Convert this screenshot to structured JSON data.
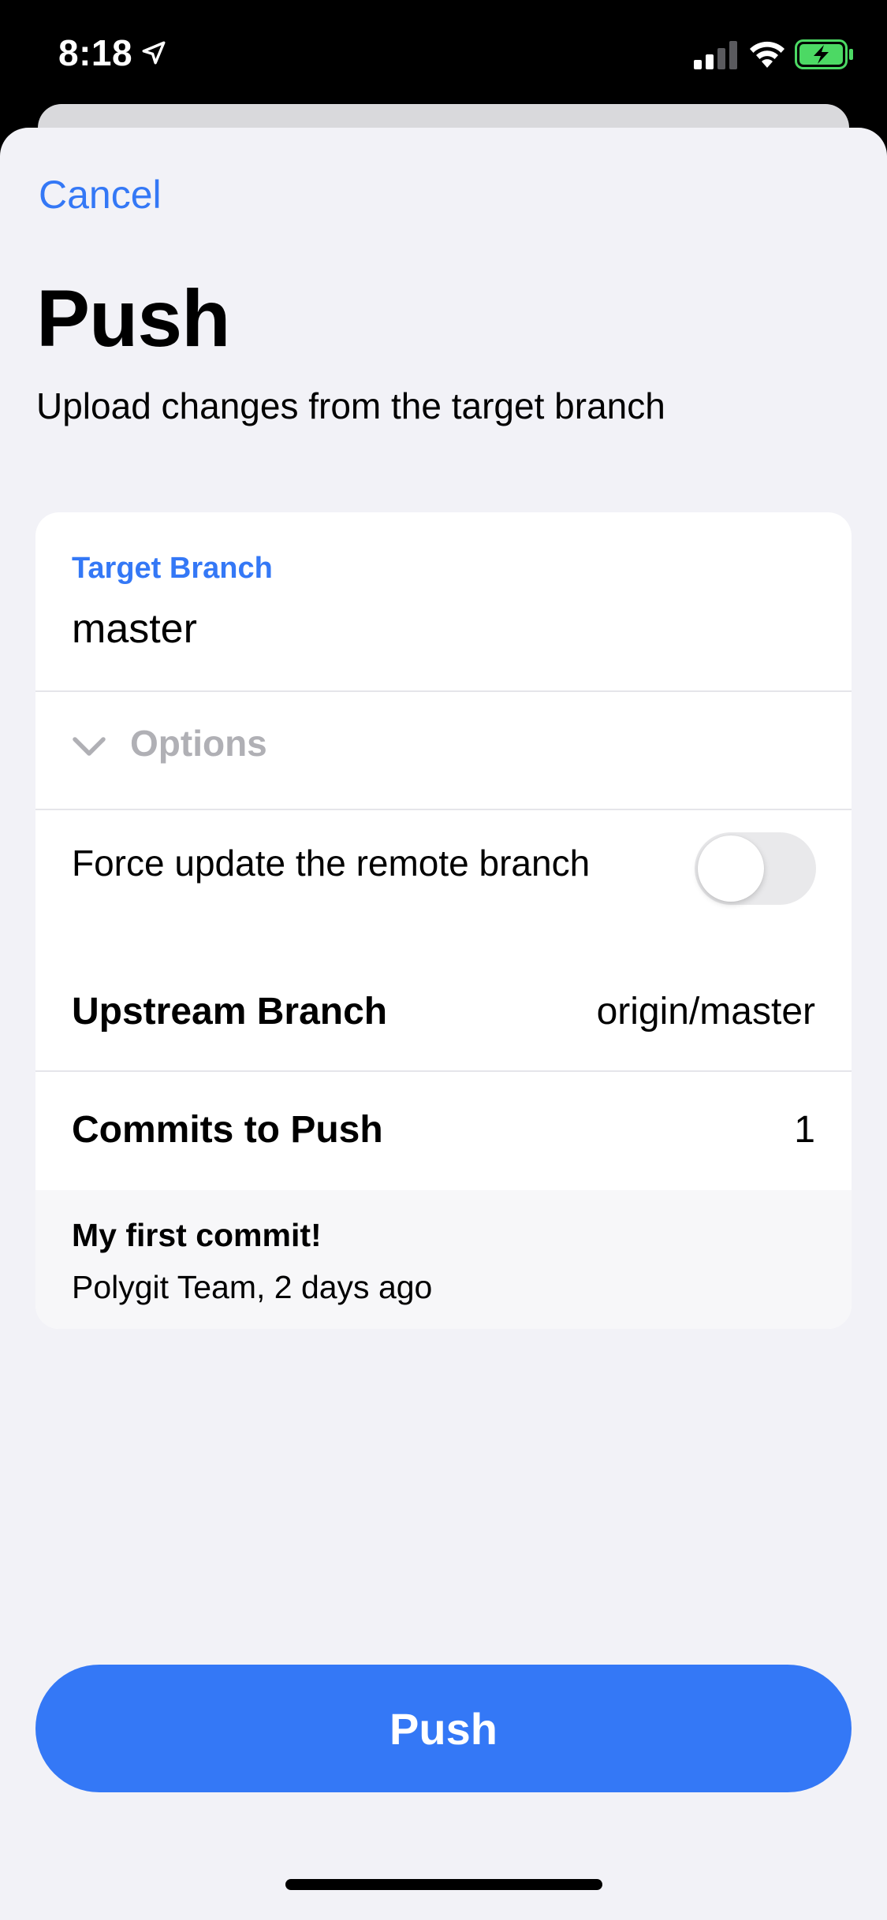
{
  "status_bar": {
    "time": "8:18",
    "location_icon": "location-arrow-icon",
    "signal_icon": "cellular-signal-icon",
    "wifi_icon": "wifi-icon",
    "battery_icon": "battery-charging-icon",
    "battery_color": "#4cd964"
  },
  "nav": {
    "cancel_label": "Cancel"
  },
  "header": {
    "title": "Push",
    "subtitle": "Upload changes from the target branch"
  },
  "target_branch": {
    "label": "Target Branch",
    "value": "master"
  },
  "options": {
    "label": "Options",
    "icon": "chevron-down-icon",
    "expanded": false
  },
  "force_update": {
    "label": "Force update the remote branch",
    "enabled": false
  },
  "details": {
    "upstream_label": "Upstream Branch",
    "upstream_value": "origin/master",
    "commits_label": "Commits to Push",
    "commits_value": "1"
  },
  "commits": [
    {
      "message": "My first commit!",
      "meta": "Polygit Team, 2 days ago"
    }
  ],
  "actions": {
    "push_label": "Push"
  },
  "colors": {
    "accent": "#3478f6",
    "background": "#f2f2f7",
    "card": "#ffffff",
    "muted_text": "#b0b0b5"
  }
}
